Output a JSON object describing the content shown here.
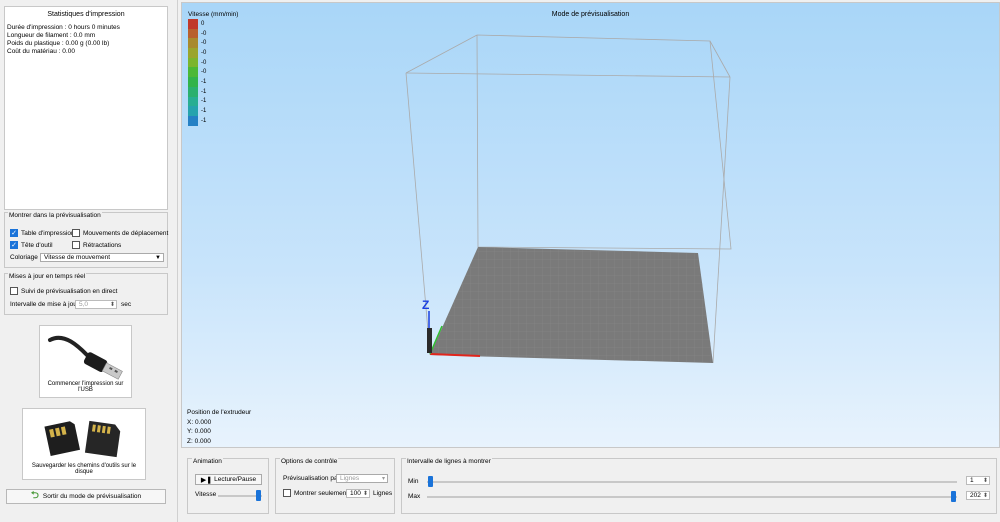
{
  "stats": {
    "title": "Statistiques d'impression",
    "lines": [
      "Durée d'impression : 0 hours 0 minutes",
      "Longueur de filament : 0.0 mm",
      "Poids du plastique : 0.00 g (0.00 lb)",
      "Coût du matériau : 0.00"
    ]
  },
  "preview": {
    "title": "Montrer dans la prévisualisation",
    "print_bed": {
      "label": "Table d'impression",
      "checked": true
    },
    "travel_moves": {
      "label": "Mouvements de déplacement",
      "checked": false
    },
    "toolhead": {
      "label": "Tête d'outil",
      "checked": true
    },
    "retractions": {
      "label": "Rétractations",
      "checked": false
    },
    "coloring_label": "Coloriage",
    "coloring_value": "Vitesse de mouvement"
  },
  "live": {
    "title": "Mises à jour en temps réel",
    "follow": {
      "label": "Suivi de prévisualisation en direct",
      "checked": false
    },
    "interval_label": "Intervalle de mise à jour",
    "interval_value": "5,0",
    "interval_unit": "sec"
  },
  "usb_card": {
    "label": "Commencer l'impression sur l'USB",
    "icon": "usb-cable-icon"
  },
  "sd_card": {
    "label": "Sauvegarder les chemins d'outils sur le disque",
    "icon": "sd-card-icon"
  },
  "exit_button": {
    "label": "Sortir du mode de prévisualisation",
    "icon": "back-arrow-icon"
  },
  "viewport": {
    "title": "Mode de prévisualisation",
    "legend_title": "Vitesse (mm/min)",
    "legend": [
      {
        "color": "#c0392b",
        "value": "0"
      },
      {
        "color": "#b8602e",
        "value": "-0"
      },
      {
        "color": "#a88a2e",
        "value": "-0"
      },
      {
        "color": "#9aa52d",
        "value": "-0"
      },
      {
        "color": "#7bb52e",
        "value": "-0"
      },
      {
        "color": "#4cb836",
        "value": "-0"
      },
      {
        "color": "#32b34a",
        "value": "-1"
      },
      {
        "color": "#2bb06e",
        "value": "-1"
      },
      {
        "color": "#28ae92",
        "value": "-1"
      },
      {
        "color": "#26a3ad",
        "value": "-1"
      },
      {
        "color": "#2580c4",
        "value": "-1"
      }
    ],
    "z_label": "Z",
    "extruder": {
      "title": "Position de l'extrudeur",
      "x": "X: 0.000",
      "y": "Y: 0.000",
      "z": "Z: 0.000"
    }
  },
  "animation": {
    "title": "Animation",
    "play_label": "Lecture/Pause",
    "speed_label": "Vitesse",
    "speed_fraction": 0.9
  },
  "control": {
    "title": "Options de contrôle",
    "preview_by_label": "Prévisualisation par",
    "preview_by_value": "Lignes",
    "show_only_label": "Montrer seulement",
    "show_only_value": "100",
    "show_only_unit": "Lignes"
  },
  "line_range": {
    "title": "Intervalle de lignes à montrer",
    "min_label": "Min",
    "min_value": "1",
    "max_label": "Max",
    "max_value": "202"
  }
}
